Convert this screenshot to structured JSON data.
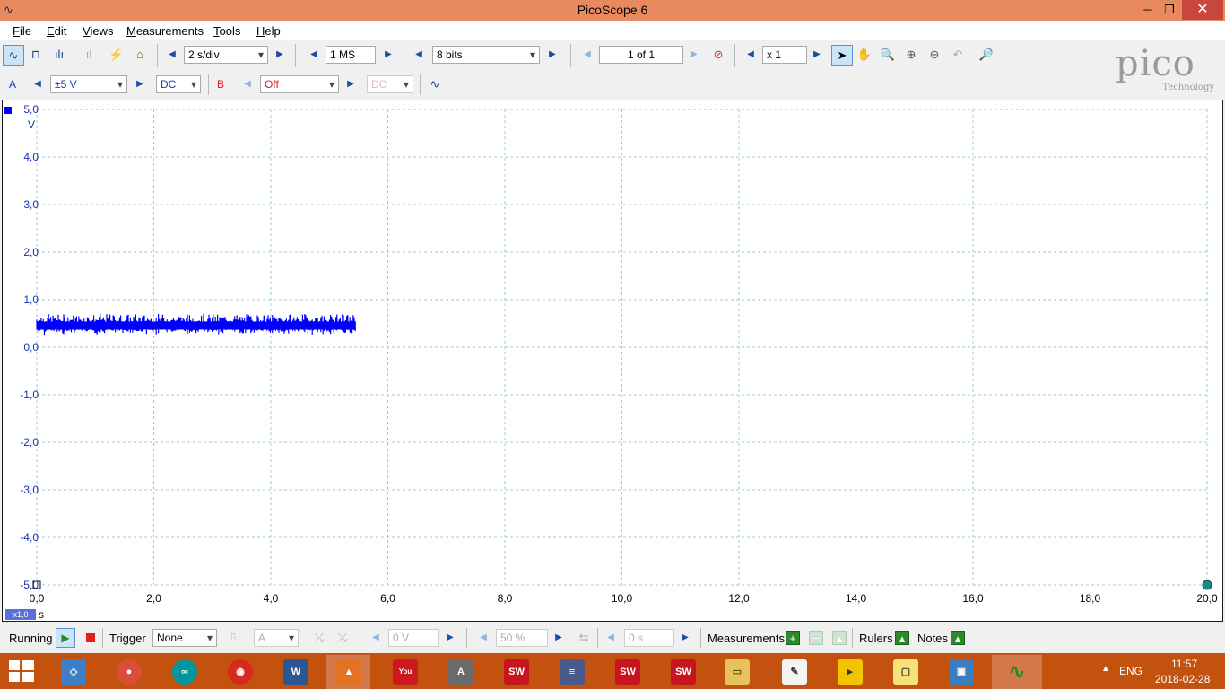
{
  "window": {
    "title": "PicoScope 6",
    "minimize": "─",
    "maximize": "❐",
    "close": "✕"
  },
  "menu": [
    "File",
    "Edit",
    "Views",
    "Measurements",
    "Tools",
    "Help"
  ],
  "toolbar1": {
    "timebase": "2 s/div",
    "samples": "1 MS",
    "resolution": "8 bits",
    "buffer": "1 of 1",
    "zoom": "x 1"
  },
  "toolbar2": {
    "channel_a": "A",
    "range_a": "±5 V",
    "coupling_a": "DC",
    "channel_b": "B",
    "range_b": "Off",
    "coupling_b": "DC"
  },
  "logo": {
    "brand": "pico",
    "sub": "Technology"
  },
  "chart_data": {
    "type": "line",
    "title": "",
    "xlabel": "s",
    "ylabel": "V",
    "xlim": [
      0,
      20
    ],
    "ylim": [
      -5,
      5
    ],
    "grid": true,
    "x_ticks": [
      "0,0",
      "2,0",
      "4,0",
      "6,0",
      "8,0",
      "10,0",
      "12,0",
      "14,0",
      "16,0",
      "18,0",
      "20,0"
    ],
    "y_ticks": [
      "5,0",
      "4,0",
      "3,0",
      "2,0",
      "1,0",
      "0,0",
      "-1,0",
      "-2,0",
      "-3,0",
      "-4,0",
      "-5,0"
    ],
    "x_zoom_badge": "x1,0",
    "series": [
      {
        "name": "A",
        "color": "#0000ff",
        "x_start": 0.0,
        "x_end": 5.45,
        "mean": 0.45,
        "min": 0.25,
        "max": 0.7
      }
    ]
  },
  "statusbar": {
    "state": "Running",
    "trigger_label": "Trigger",
    "trigger_mode": "None",
    "trigger_source": "A",
    "trigger_level": "0 V",
    "trigger_position": "50 %",
    "trigger_delay": "0 s",
    "measurements": "Measurements",
    "rulers": "Rulers",
    "notes": "Notes"
  },
  "taskbar": {
    "language": "ENG",
    "time": "11:57",
    "date": "2018-02-28"
  }
}
